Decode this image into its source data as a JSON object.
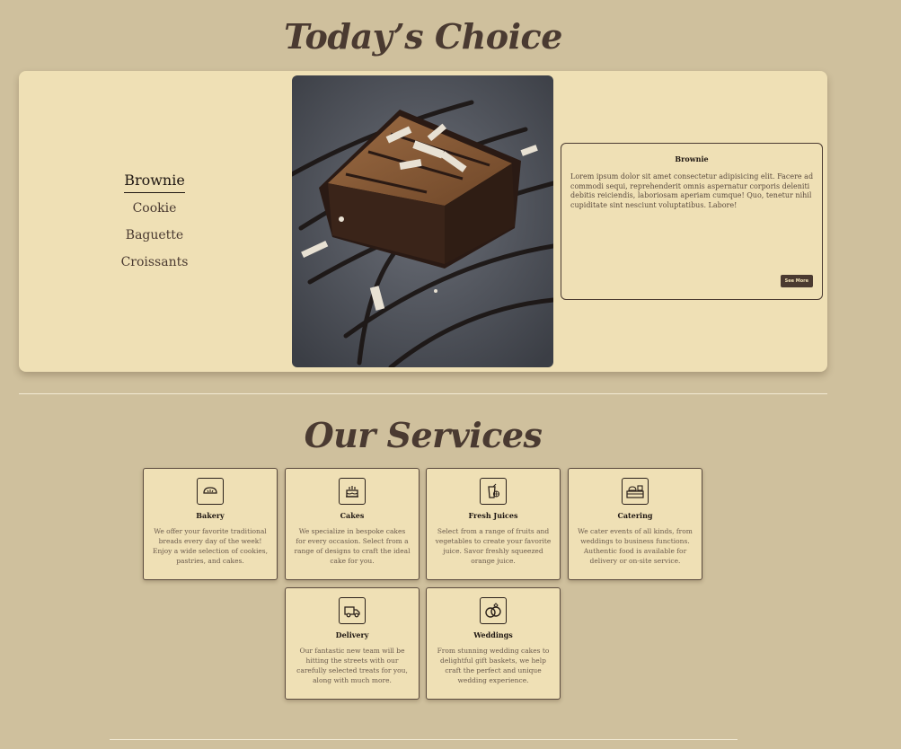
{
  "todays_choice": {
    "title": "Today’s Choice",
    "menu_items": [
      "Brownie",
      "Cookie",
      "Baguette",
      "Croissants"
    ],
    "selected": "Brownie",
    "detail": {
      "title": "Brownie",
      "text": "Lorem ipsum dolor sit amet consectetur adipisicing elit. Facere ad commodi sequi, reprehenderit omnis aspernatur corporis deleniti debitis reiciendis, laboriosam aperiam cumque! Quo, tenetur nihil cupiditate sint nesciunt voluptatibus. Labore!",
      "button": "See More"
    }
  },
  "services": {
    "title": "Our Services",
    "items": [
      {
        "icon": "bread-icon",
        "title": "Bakery",
        "text": "We offer your favorite traditional breads every day of the week! Enjoy a wide selection of cookies, pastries, and cakes."
      },
      {
        "icon": "cake-icon",
        "title": "Cakes",
        "text": "We specialize in bespoke cakes for every occasion. Select from a range of designs to craft the ideal cake for you."
      },
      {
        "icon": "juice-icon",
        "title": "Fresh Juices",
        "text": "Select from a range of fruits and vegetables to create your favorite juice. Savor freshly squeezed orange juice."
      },
      {
        "icon": "catering-icon",
        "title": "Catering",
        "text": "We cater events of all kinds, from weddings to business functions. Authentic food is available for delivery or on-site service."
      },
      {
        "icon": "delivery-truck-icon",
        "title": "Delivery",
        "text": "Our fantastic new team will be hitting the streets with our carefully selected treats for you, along with much more."
      },
      {
        "icon": "wedding-rings-icon",
        "title": "Weddings",
        "text": "From stunning wedding cakes to delightful gift baskets, we help craft the perfect and unique wedding experience."
      }
    ]
  },
  "colors": {
    "background": "#cfc09d",
    "card": "#efe0b5",
    "text_dark": "#4a3a31",
    "accent_button": "#4a3a31"
  }
}
